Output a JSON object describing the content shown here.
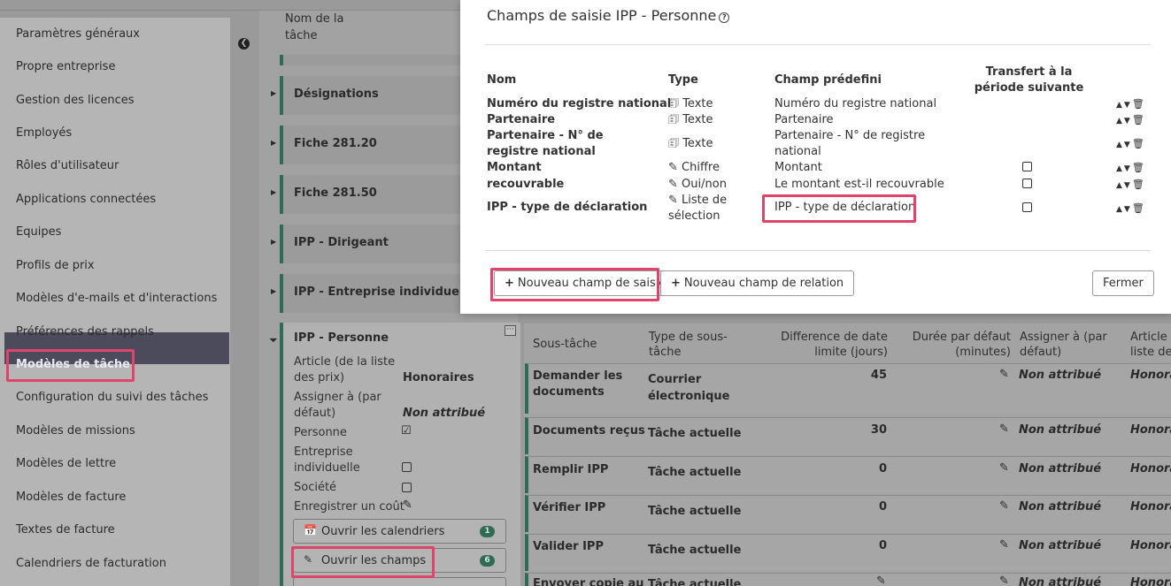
{
  "sidebar": {
    "items": [
      "Paramètres généraux",
      "Propre entreprise",
      "Gestion des licences",
      "Employés",
      "Rôles d'utilisateur",
      "Applications connectées",
      "Equipes",
      "Profils de prix",
      "Modèles d'e-mails et d'interactions",
      "Préférences des rappels",
      "Modèles de tâche",
      "Configuration du suivi des tâches",
      "Modèles de missions",
      "Modèles de lettre",
      "Modèles de facture",
      "Textes de facture",
      "Calendriers de facturation"
    ],
    "active_item": "Modèles de tâche"
  },
  "tasks": {
    "header": "Nom de la tâche",
    "rows": [
      "Désignations",
      "Fiche 281.20",
      "Fiche 281.50",
      "IPP - Dirigeant",
      "IPP - Entreprise individuelle"
    ],
    "expanded": {
      "title": "IPP - Personne",
      "article_label": "Article (de la liste des prix)",
      "article_value": "Honoraires",
      "assign_label": "Assigner à (par défaut)",
      "assign_value": "Non attribué",
      "personne_label": "Personne",
      "entreprise_label": "Entreprise individuelle",
      "societe_label": "Société",
      "cost_label": "Enregistrer un coût",
      "btn_calendars": "Ouvrir les calendriers",
      "btn_calendars_count": "1",
      "btn_fields": "Ouvrir les champs",
      "btn_fields_count": "6"
    }
  },
  "subtasks": {
    "headers": {
      "name": "Sous-tâche",
      "type": "Type de sous-tâche",
      "diff": "Difference de date limite (jours)",
      "duration": "Durée par défaut (minutes)",
      "assign": "Assigner à (par défaut)",
      "article": "Article (de la liste des prix)"
    },
    "rows": [
      {
        "name": "Demander les documents",
        "type": "Courrier électronique",
        "diff": "45",
        "assign": "Non attribué",
        "article": "Honoraires"
      },
      {
        "name": "Documents reçus",
        "type": "Tâche actuelle",
        "diff": "30",
        "assign": "Non attribué",
        "article": "Honoraires"
      },
      {
        "name": "Remplir IPP",
        "type": "Tâche actuelle",
        "diff": "0",
        "assign": "Non attribué",
        "article": "Honoraires"
      },
      {
        "name": "Vérifier IPP",
        "type": "Tâche actuelle",
        "diff": "0",
        "assign": "Non attribué",
        "article": "Honoraires"
      },
      {
        "name": "Valider IPP",
        "type": "Tâche actuelle",
        "diff": "0",
        "assign": "Non attribué",
        "article": "Honoraires"
      },
      {
        "name": "Envoyer copie au",
        "type": "Tâche actuelle",
        "diff": "",
        "assign": "Non attribué",
        "article": "Honoraires"
      }
    ]
  },
  "modal": {
    "title": "Champs de saisie IPP - Personne",
    "columns": {
      "name": "Nom",
      "type": "Type",
      "predefined": "Champ prédefini",
      "transfer": "Transfert à la période suivante"
    },
    "fields": [
      {
        "name": "Numéro du registre national",
        "type": "Texte",
        "type_icon": "id-card-icon",
        "predefined": "Numéro du registre national",
        "checkbox": false
      },
      {
        "name": "Partenaire",
        "type": "Texte",
        "type_icon": "id-card-icon",
        "predefined": "Partenaire",
        "checkbox": false
      },
      {
        "name": "Partenaire - N° de registre national",
        "type": "Texte",
        "type_icon": "id-card-icon",
        "predefined": "Partenaire - N° de registre national",
        "checkbox": false
      },
      {
        "name": "Montant",
        "type": "Chiffre",
        "type_icon": "edit-icon",
        "predefined": "Montant",
        "checkbox": true
      },
      {
        "name": "recouvrable",
        "type": "Oui/non",
        "type_icon": "edit-icon",
        "predefined": "Le montant est-il recouvrable",
        "checkbox": true
      },
      {
        "name": "IPP - type de déclaration",
        "type": "Liste de sélection",
        "type_icon": "edit-icon",
        "predefined": "IPP - type de déclaration",
        "checkbox": true
      }
    ],
    "btn_new_input": "Nouveau champ de saisie",
    "btn_new_relation": "Nouveau champ de relation",
    "btn_close": "Fermer"
  },
  "colors": {
    "accent_green": "#2f6b55",
    "highlight": "#e0436b",
    "active_sidebar": "#4c4b5c"
  }
}
